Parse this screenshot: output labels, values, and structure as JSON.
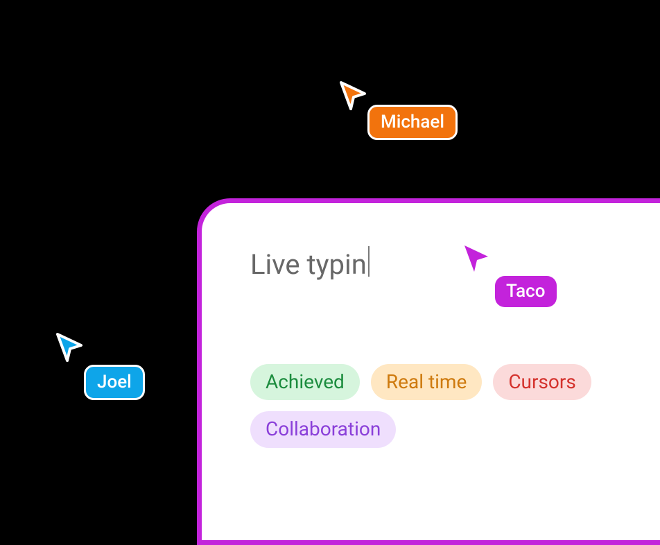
{
  "cursors": {
    "michael": {
      "label": "Michael",
      "color": "#F2730D"
    },
    "joel": {
      "label": "Joel",
      "color": "#0EA5E9"
    },
    "taco": {
      "label": "Taco",
      "color": "#C323DB"
    }
  },
  "card": {
    "typing_text": "Live typin",
    "border_color": "#C323DB",
    "tags": [
      {
        "label": "Achieved",
        "bg": "#D6F5DD",
        "fg": "#1C8C3E"
      },
      {
        "label": "Real time",
        "bg": "#FFE7C2",
        "fg": "#CE7A0E"
      },
      {
        "label": "Cursors",
        "bg": "#FBDADA",
        "fg": "#D4322D"
      },
      {
        "label": "Collaboration",
        "bg": "#EFDFFD",
        "fg": "#8A3FD9"
      }
    ]
  }
}
